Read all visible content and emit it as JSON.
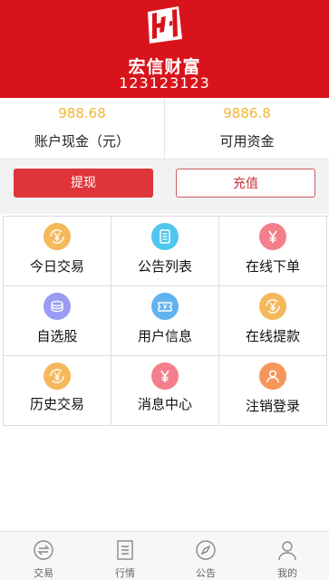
{
  "header": {
    "brand_name": "宏信财富",
    "user_id": "123123123",
    "background_color": "#d9131b"
  },
  "balances": {
    "cash": {
      "amount": "988.68",
      "label": "账户现金（元）"
    },
    "available": {
      "amount": "9886.8",
      "label": "可用资金"
    }
  },
  "actions": {
    "withdraw_label": "提现",
    "recharge_label": "充值"
  },
  "grid": {
    "items": [
      {
        "label": "今日交易",
        "icon": "yen-refresh-icon",
        "color": "#f5b85a"
      },
      {
        "label": "公告列表",
        "icon": "document-icon",
        "color": "#4fc6ee"
      },
      {
        "label": "在线下单",
        "icon": "yen-icon",
        "color": "#f47f8c"
      },
      {
        "label": "自选股",
        "icon": "coins-icon",
        "color": "#9a9bf2"
      },
      {
        "label": "用户信息",
        "icon": "ticket-icon",
        "color": "#61b3ef"
      },
      {
        "label": "在线提款",
        "icon": "yen-refresh-icon",
        "color": "#f5b85a"
      },
      {
        "label": "历史交易",
        "icon": "yen-refresh-icon",
        "color": "#f5b85a"
      },
      {
        "label": "消息中心",
        "icon": "yen-icon",
        "color": "#f47f8c"
      },
      {
        "label": "注销登录",
        "icon": "user-icon",
        "color": "#f7965a"
      }
    ]
  },
  "tabbar": {
    "items": [
      {
        "label": "交易",
        "icon": "exchange-icon"
      },
      {
        "label": "行情",
        "icon": "list-icon"
      },
      {
        "label": "公告",
        "icon": "compass-icon"
      },
      {
        "label": "我的",
        "icon": "person-icon"
      }
    ]
  }
}
